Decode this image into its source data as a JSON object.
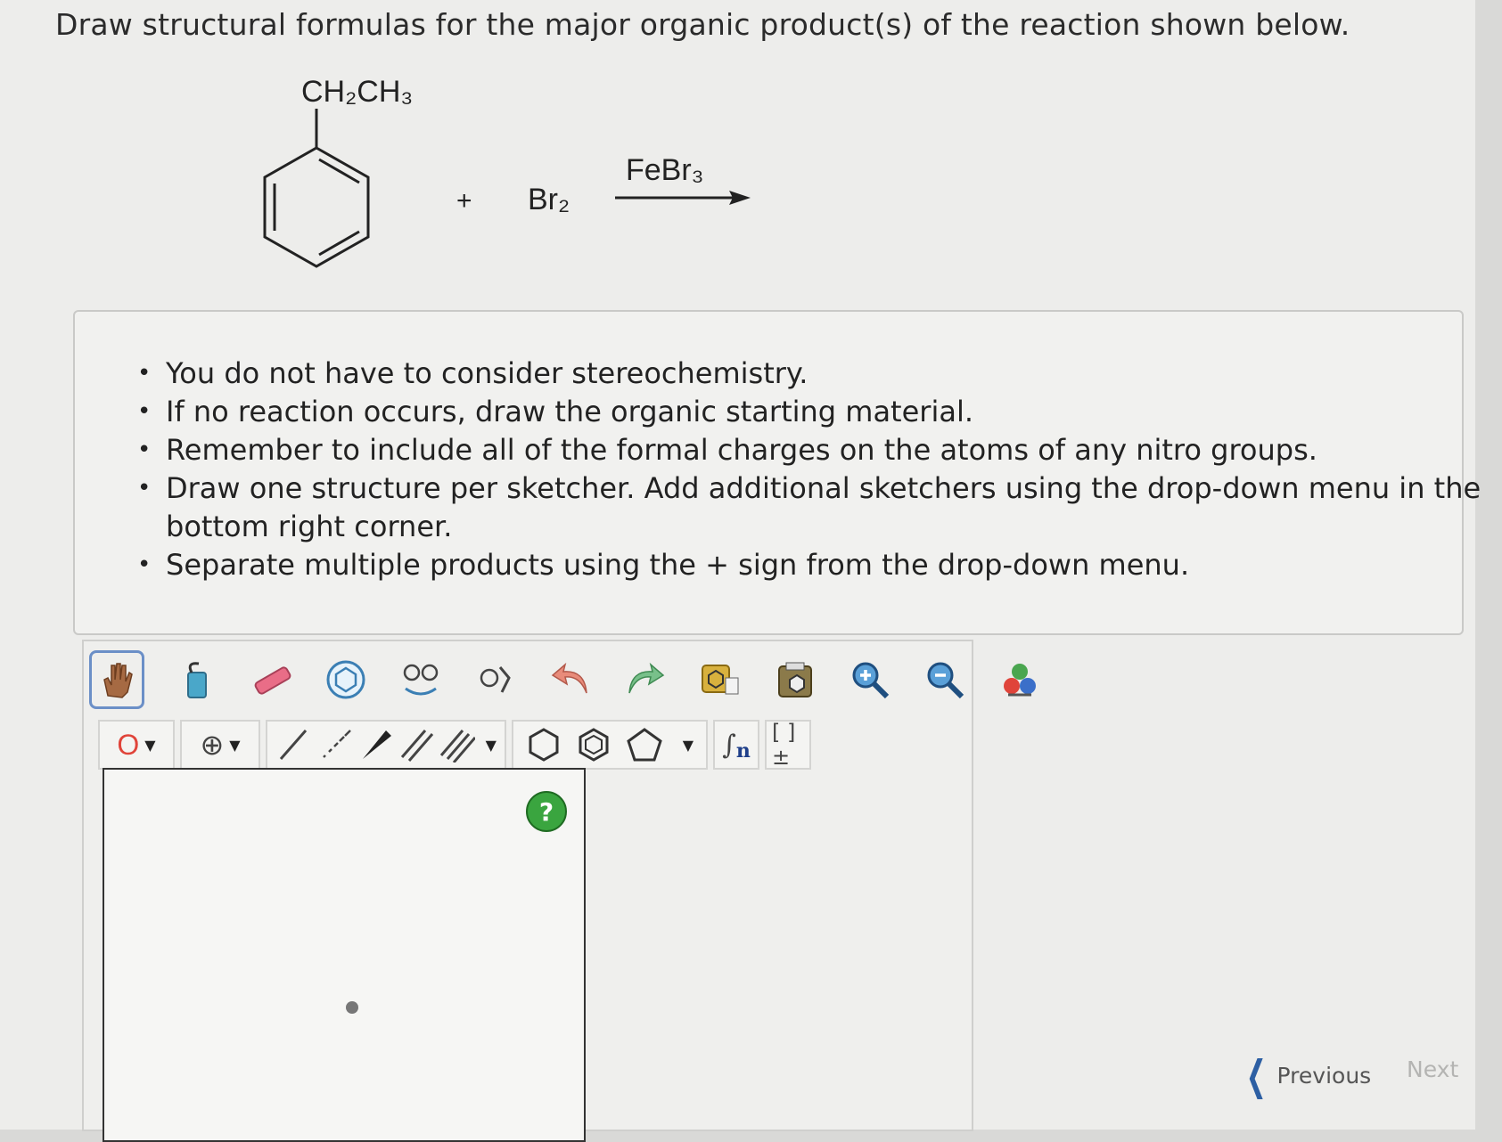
{
  "question": "Draw structural formulas for the major organic product(s) of the reaction shown below.",
  "reaction": {
    "substituent": "CH₂CH₃",
    "plus": "+",
    "reagent": "Br₂",
    "catalyst": "FeBr₃"
  },
  "instructions": [
    "You do not have to consider stereochemistry.",
    "If no reaction occurs, draw the organic starting material.",
    "Remember to include all of the formal charges on the atoms of any nitro groups.",
    "Draw one structure per sketcher. Add additional sketchers using the drop-down menu in the",
    "bottom right corner.",
    "Separate multiple products using the + sign from the drop-down menu."
  ],
  "toolbar": {
    "row1_icons": [
      "hand-icon",
      "paste-icon",
      "eraser-icon",
      "ring-icon",
      "clean-icon",
      "fragment-icon",
      "undo-icon",
      "redo-icon",
      "copy-icon",
      "clipboard-icon",
      "zoom-in-icon",
      "zoom-out-icon",
      "atom-colors-icon"
    ],
    "atom_label": "O",
    "charge_label": "⊕",
    "bracket_label": "[ ]±",
    "sgroup_label": "n"
  },
  "help_label": "?",
  "nav": {
    "previous": "Previous",
    "next": "Next"
  },
  "colors": {
    "accent": "#2d5fa3",
    "help": "#3aa53f",
    "atom": "#e0443a"
  }
}
